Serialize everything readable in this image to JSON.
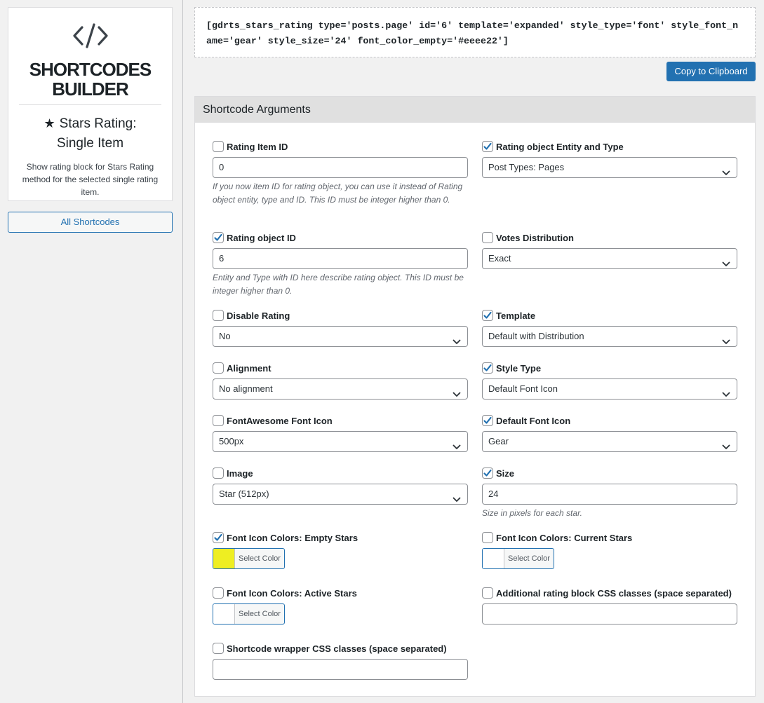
{
  "sidebar": {
    "logo_title_line1": "SHORTCODES",
    "logo_title_line2": "BUILDER",
    "shortcode_name_line1": "Stars Rating:",
    "shortcode_name_line2": "Single Item",
    "shortcode_description": "Show rating block for Stars Rating method for the selected single rating item.",
    "all_shortcodes_label": "All Shortcodes"
  },
  "shortcode_text": "[gdrts_stars_rating type='posts.page' id='6' template='expanded' style_type='font' style_font_name='gear' style_size='24' font_color_empty='#eeee22']",
  "copy_button_label": "Copy to Clipboard",
  "panel_title": "Shortcode Arguments",
  "fields": {
    "rating_item_id": {
      "label": "Rating Item ID",
      "checked": false,
      "value": "0",
      "hint": "If you now item ID for rating object, you can use it instead of Rating object entity, type and ID. This ID must be integer higher than 0."
    },
    "entity_type": {
      "label": "Rating object Entity and Type",
      "checked": true,
      "value": "Post Types: Pages"
    },
    "rating_object_id": {
      "label": "Rating object ID",
      "checked": true,
      "value": "6",
      "hint": "Entity and Type with ID here describe rating object. This ID must be integer higher than 0."
    },
    "votes_distribution": {
      "label": "Votes Distribution",
      "checked": false,
      "value": "Exact"
    },
    "disable_rating": {
      "label": "Disable Rating",
      "checked": false,
      "value": "No"
    },
    "template": {
      "label": "Template",
      "checked": true,
      "value": "Default with Distribution"
    },
    "alignment": {
      "label": "Alignment",
      "checked": false,
      "value": "No alignment"
    },
    "style_type": {
      "label": "Style Type",
      "checked": true,
      "value": "Default Font Icon"
    },
    "fontawesome_icon": {
      "label": "FontAwesome Font Icon",
      "checked": false,
      "value": "500px"
    },
    "default_font_icon": {
      "label": "Default Font Icon",
      "checked": true,
      "value": "Gear"
    },
    "image": {
      "label": "Image",
      "checked": false,
      "value": "Star (512px)"
    },
    "size": {
      "label": "Size",
      "checked": true,
      "value": "24",
      "hint": "Size in pixels for each star."
    },
    "color_empty": {
      "label": "Font Icon Colors: Empty Stars",
      "checked": true,
      "button_label": "Select Color",
      "color": "#eeee22"
    },
    "color_current": {
      "label": "Font Icon Colors: Current Stars",
      "checked": false,
      "button_label": "Select Color",
      "color": "#ffffff"
    },
    "color_active": {
      "label": "Font Icon Colors: Active Stars",
      "checked": false,
      "button_label": "Select Color",
      "color": "#ffffff"
    },
    "css_classes": {
      "label": "Additional rating block CSS classes (space separated)",
      "checked": false,
      "value": ""
    },
    "wrapper_classes": {
      "label": "Shortcode wrapper CSS classes (space separated)",
      "checked": false,
      "value": ""
    }
  },
  "colors": {
    "accent": "#2271b1",
    "empty_star_color": "#eeee22"
  }
}
